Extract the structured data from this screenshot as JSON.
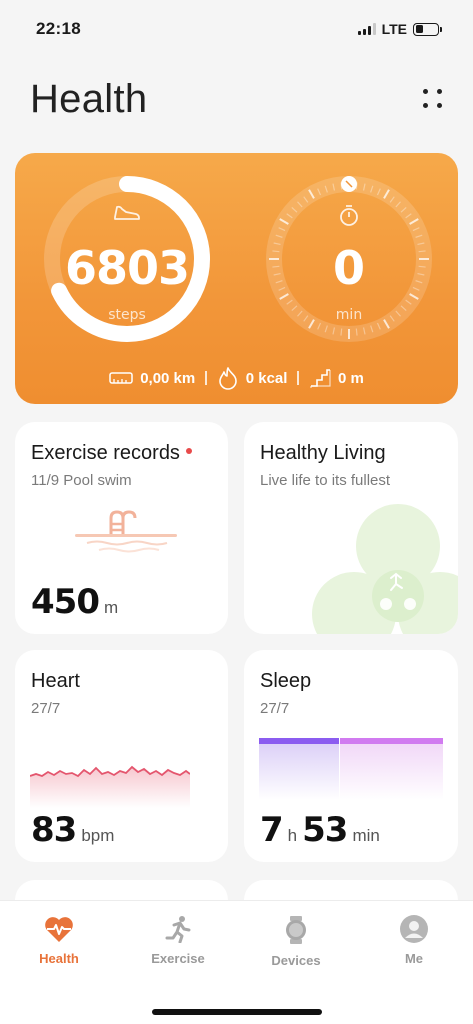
{
  "status": {
    "time": "22:18",
    "network": "LTE"
  },
  "header": {
    "title": "Health"
  },
  "activity": {
    "steps_value": "6803",
    "steps_unit": "steps",
    "steps_progress": 0.68,
    "minutes_value": "0",
    "minutes_unit": "min",
    "distance": "0,00 km",
    "calories": "0 kcal",
    "floors": "0 m"
  },
  "tiles": {
    "exercise": {
      "title": "Exercise records",
      "subtitle": "11/9 Pool swim",
      "value": "450",
      "unit": "m"
    },
    "healthy": {
      "title": "Healthy Living",
      "subtitle": "Live life to its fullest"
    },
    "heart": {
      "title": "Heart",
      "subtitle": "27/7",
      "value": "83",
      "unit": "bpm"
    },
    "sleep": {
      "title": "Sleep",
      "subtitle": "27/7",
      "hours": "7",
      "hours_unit": "h",
      "minutes": "53",
      "minutes_unit": "min"
    }
  },
  "tabbar": {
    "items": [
      {
        "label": "Health",
        "icon": "heart-pulse-icon"
      },
      {
        "label": "Exercise",
        "icon": "running-icon"
      },
      {
        "label": "Devices",
        "icon": "watch-icon"
      },
      {
        "label": "Me",
        "icon": "avatar-icon"
      }
    ]
  },
  "colors": {
    "accent": "#e8733a",
    "card_orange": "#f29639",
    "heart_line": "#e4566e",
    "sleep_deep": "#8b5cf0",
    "sleep_light": "#d17bf0",
    "leaf_green": "#e6f4d9"
  }
}
